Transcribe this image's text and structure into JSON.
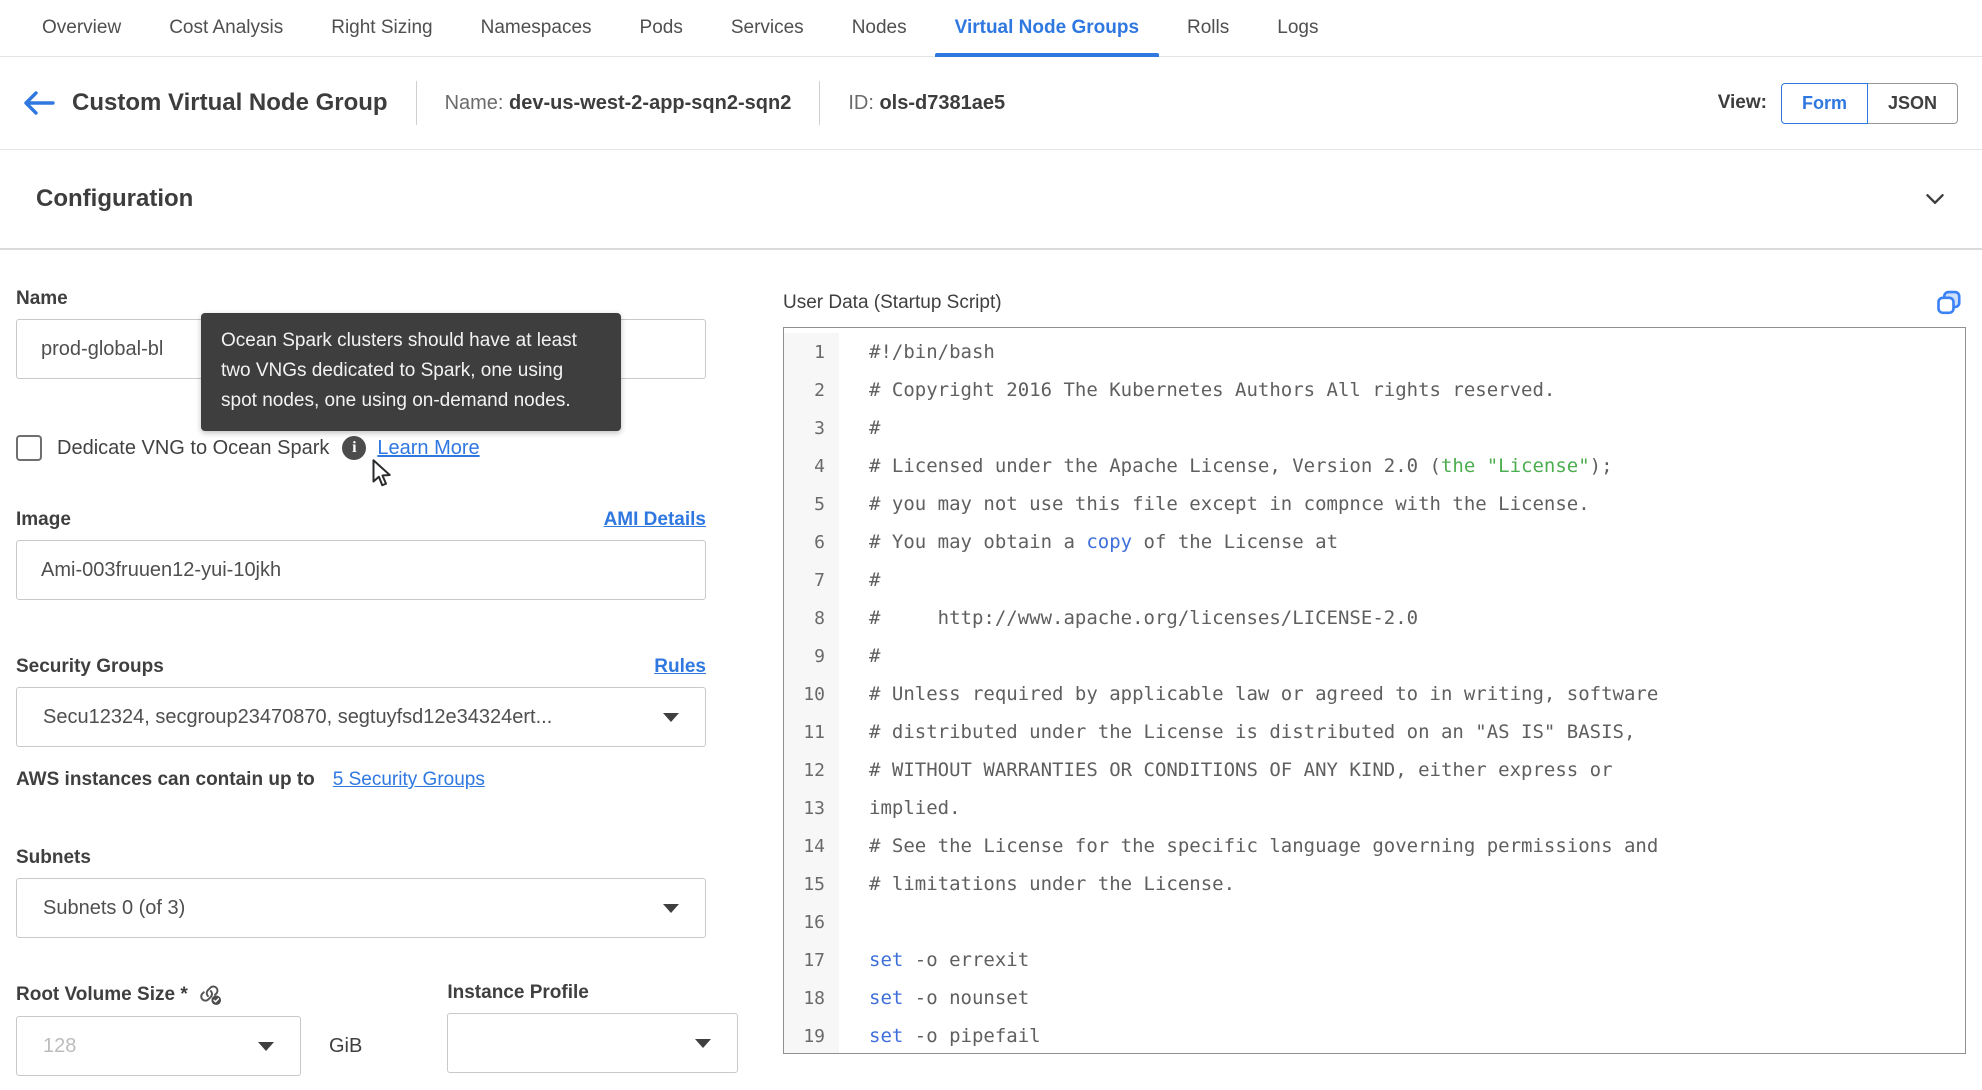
{
  "tabs": {
    "items": [
      {
        "id": "overview",
        "label": "Overview",
        "active": false
      },
      {
        "id": "cost-analysis",
        "label": "Cost Analysis",
        "active": false
      },
      {
        "id": "right-sizing",
        "label": "Right Sizing",
        "active": false
      },
      {
        "id": "namespaces",
        "label": "Namespaces",
        "active": false
      },
      {
        "id": "pods",
        "label": "Pods",
        "active": false
      },
      {
        "id": "services",
        "label": "Services",
        "active": false
      },
      {
        "id": "nodes",
        "label": "Nodes",
        "active": false
      },
      {
        "id": "virtual-node-groups",
        "label": "Virtual Node Groups",
        "active": true
      },
      {
        "id": "rolls",
        "label": "Rolls",
        "active": false
      },
      {
        "id": "logs",
        "label": "Logs",
        "active": false
      }
    ]
  },
  "header": {
    "title": "Custom Virtual Node Group",
    "name_label": "Name:",
    "name_value": "dev-us-west-2-app-sqn2-sqn2",
    "id_label": "ID:",
    "id_value": "ols-d7381ae5",
    "view_label": "View:",
    "view_options": [
      "Form",
      "JSON"
    ],
    "active_view": "Form"
  },
  "section": {
    "title": "Configuration"
  },
  "form": {
    "name": {
      "label": "Name",
      "value": "prod-global-bl"
    },
    "tooltip": {
      "text": "Ocean Spark clusters should have at least two VNGs dedicated to Spark, one using spot nodes, one using on-demand nodes."
    },
    "dedicate": {
      "label": "Dedicate VNG to Ocean Spark",
      "checked": false,
      "link": "Learn More"
    },
    "image": {
      "label": "Image",
      "link": "AMI Details",
      "value": "Ami-003fruuen12-yui-10jkh"
    },
    "security_groups": {
      "label": "Security Groups",
      "link": "Rules",
      "value": "Secu12324, secgroup23470870, segtuyfsd12e34324ert...",
      "caption": "AWS instances can contain up to",
      "caption_link": "5 Security Groups"
    },
    "subnets": {
      "label": "Subnets",
      "value": "Subnets 0 (of 3)"
    },
    "root_volume": {
      "label": "Root Volume Size *",
      "placeholder": "128",
      "unit": "GiB"
    },
    "instance_profile": {
      "label": "Instance Profile",
      "value": ""
    }
  },
  "editor": {
    "title": "User Data (Startup Script)",
    "lines": [
      {
        "n": "1",
        "seg": [
          [
            "#!/bin/bash",
            "d"
          ]
        ]
      },
      {
        "n": "2",
        "seg": [
          [
            "# Copyright 2016 The Kubernetes Authors All rights reserved.",
            "d"
          ]
        ]
      },
      {
        "n": "3",
        "seg": [
          [
            "#",
            "d"
          ]
        ]
      },
      {
        "n": "4",
        "seg": [
          [
            "# Licensed under the Apache License, Version 2.0 (",
            "d"
          ],
          [
            "the \"License\"",
            "g"
          ],
          [
            ");",
            "d"
          ]
        ]
      },
      {
        "n": "5",
        "seg": [
          [
            "# you may not use this file except in compnce with the License.",
            "d"
          ]
        ]
      },
      {
        "n": "6",
        "seg": [
          [
            "# You may obtain a ",
            "d"
          ],
          [
            "copy",
            "b"
          ],
          [
            " of the License at",
            "d"
          ]
        ]
      },
      {
        "n": "7",
        "seg": [
          [
            "#",
            "d"
          ]
        ]
      },
      {
        "n": "8",
        "seg": [
          [
            "#     http://www.apache.org/licenses/LICENSE-2.0",
            "d"
          ]
        ]
      },
      {
        "n": "9",
        "seg": [
          [
            "#",
            "d"
          ]
        ]
      },
      {
        "n": "10",
        "seg": [
          [
            "# Unless required by applicable law or agreed to in writing, software",
            "d"
          ]
        ]
      },
      {
        "n": "11",
        "seg": [
          [
            "# distributed under the License is distributed on an \"AS IS\" BASIS,",
            "d"
          ]
        ]
      },
      {
        "n": "12",
        "seg": [
          [
            "# WITHOUT WARRANTIES OR CONDITIONS OF ANY KIND, either express or",
            "d"
          ]
        ]
      },
      {
        "n": "13",
        "seg": [
          [
            "implied.",
            "d"
          ]
        ]
      },
      {
        "n": "14",
        "seg": [
          [
            "# See the License for the specific language governing permissions and",
            "d"
          ]
        ]
      },
      {
        "n": "15",
        "seg": [
          [
            "# limitations under the License.",
            "d"
          ]
        ]
      },
      {
        "n": "16",
        "seg": [
          [
            "",
            "d"
          ]
        ]
      },
      {
        "n": "17",
        "seg": [
          [
            "set",
            "b"
          ],
          [
            " -o errexit",
            "d"
          ]
        ]
      },
      {
        "n": "18",
        "seg": [
          [
            "set",
            "b"
          ],
          [
            " -o nounset",
            "d"
          ]
        ]
      },
      {
        "n": "19",
        "seg": [
          [
            "set",
            "b"
          ],
          [
            " -o pipefail",
            "d"
          ]
        ]
      }
    ]
  },
  "colors": {
    "accent": "#2f78e0",
    "code_blue": "#3e6fd9",
    "code_green": "#4cae4f",
    "tooltip_bg": "#3e3e3e"
  }
}
